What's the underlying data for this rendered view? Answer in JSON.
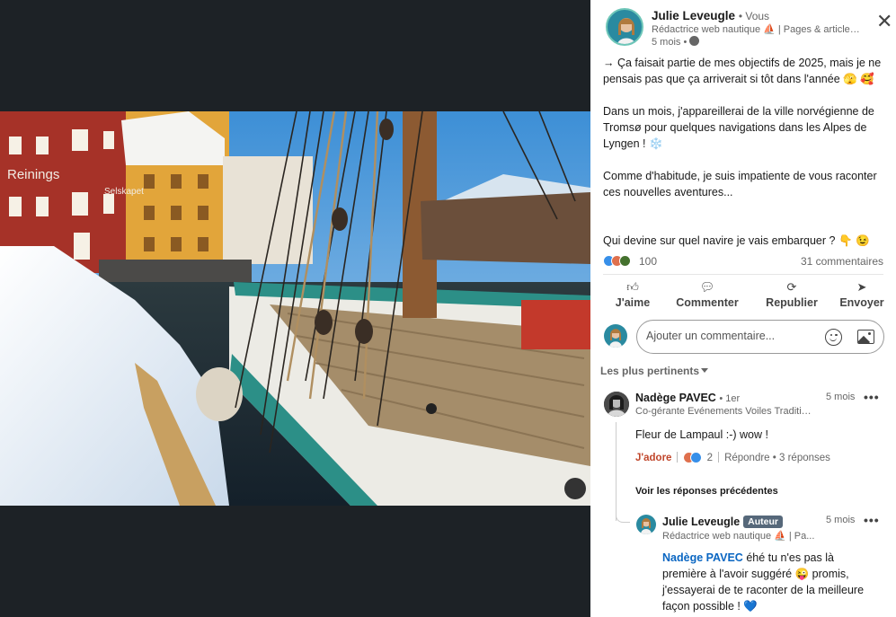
{
  "post": {
    "author": {
      "name": "Julie Leveugle",
      "you": "• Vous",
      "headline": "Rédactrice web nautique ⛵ | Pages & articles...",
      "time": "5 mois •"
    },
    "paragraphs": [
      "→ Ça faisait partie de mes objectifs de 2025, mais je ne pensais pas que ça arriverait si tôt dans l'année 🫣 🥰",
      "Dans un mois, j'appareillerai de la ville norvégienne de Tromsø pour quelques navigations dans les Alpes de Lyngen ! ❄️",
      "Comme d'habitude, je suis impatiente de vous raconter ces nouvelles aventures...",
      "Qui devine sur quel navire je vais embarquer ? 👇 😉"
    ],
    "reactions_count": "100",
    "comments_count": "31 commentaires"
  },
  "actions": {
    "like": "J'aime",
    "comment": "Commenter",
    "repost": "Republier",
    "send": "Envoyer"
  },
  "comment_box": {
    "placeholder": "Ajouter un commentaire..."
  },
  "sort_label": "Les plus pertinents",
  "comments": [
    {
      "name": "Nadège PAVEC",
      "degree": "• 1er",
      "headline": "Co-gérante Evénements Voiles Traditio...",
      "time": "5 mois",
      "text": "Fleur de Lampaul :-) wow !",
      "reaction_label": "J'adore",
      "reaction_count": "2",
      "reply_label": "Répondre",
      "replies_count": "• 3 réponses"
    }
  ],
  "previous_replies_label": "Voir les réponses précédentes",
  "reply": {
    "name": "Julie Leveugle",
    "badge": "Auteur",
    "headline": "Rédactrice web nautique ⛵ | Pa...",
    "time": "5 mois",
    "mention": "Nadège PAVEC",
    "text": "éhé tu n'es pas là première à l'avoir suggéré 😜 promis, j'essayerai de te raconter de la meilleure façon possible ! 💙"
  },
  "colors": {
    "accent_blue": "#0a66c2",
    "adore_red": "#c0462b",
    "badge_gray": "#56687a",
    "viewer_bg": "#1d2226"
  },
  "icons": {
    "close": "close-icon",
    "like": "thumbs-up-icon",
    "comment": "speech-bubble-icon",
    "repost": "repost-arrows-icon",
    "send": "paper-plane-icon",
    "emoji": "smiley-icon",
    "image": "image-icon",
    "globe": "globe-icon"
  }
}
